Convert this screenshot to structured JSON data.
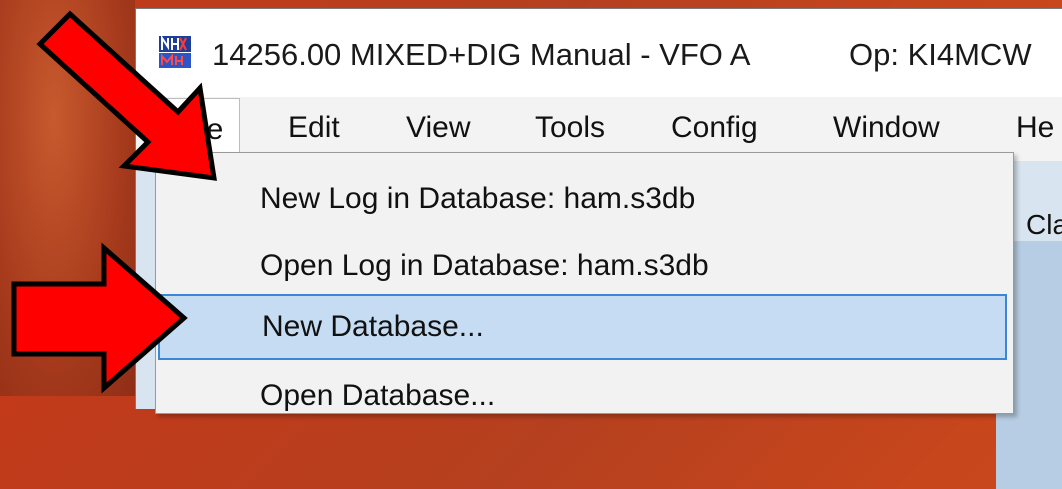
{
  "window": {
    "title": "14256.00 MIXED+DIG Manual - VFO A",
    "operator": "Op: KI4MCW"
  },
  "menu": [
    {
      "label": "File"
    },
    {
      "label": "Edit"
    },
    {
      "label": "View"
    },
    {
      "label": "Tools"
    },
    {
      "label": "Config"
    },
    {
      "label": "Window"
    },
    {
      "label": "He"
    }
  ],
  "file_menu": [
    {
      "label": "New Log in Database: ham.s3db"
    },
    {
      "label": "Open Log in Database: ham.s3db"
    },
    {
      "label": "New Database..."
    },
    {
      "label": "Open Database..."
    }
  ],
  "background_text": {
    "partial_label": "Cla"
  },
  "colors": {
    "arrow_fill": "#ff0000",
    "highlight": "#c5dcf3",
    "highlight_border": "#3b86d6"
  }
}
